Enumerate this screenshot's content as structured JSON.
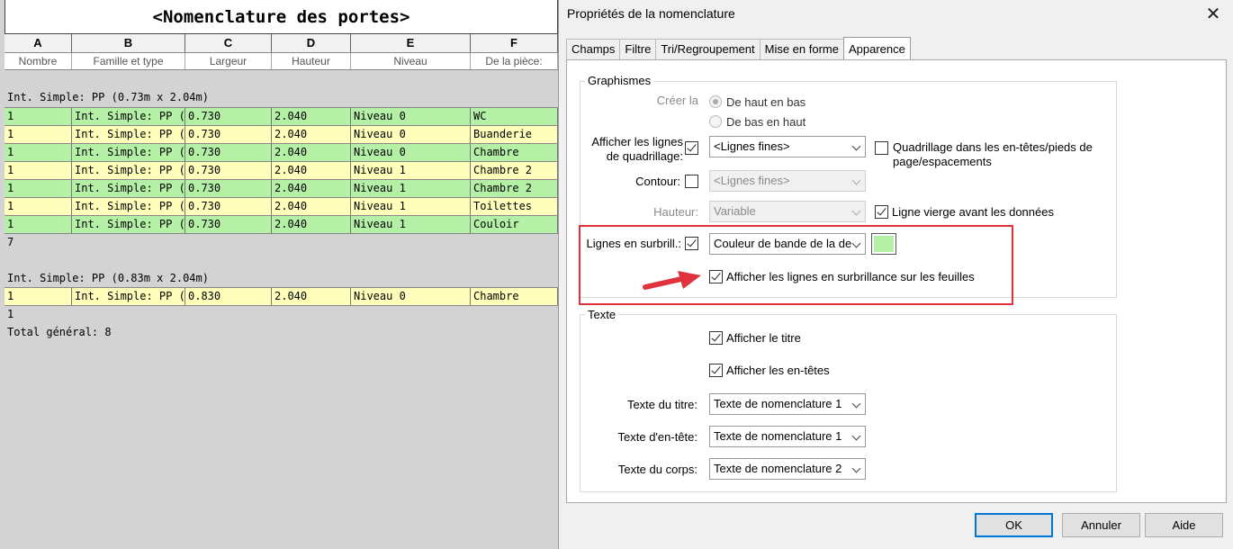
{
  "schedule": {
    "title": "<Nomenclature des portes>",
    "column_letters": [
      "A",
      "B",
      "C",
      "D",
      "E",
      "F"
    ],
    "column_headers": [
      "Nombre",
      "Famille et type",
      "Largeur",
      "Hauteur",
      "Niveau",
      "De la pièce:"
    ],
    "group1": {
      "header": "Int. Simple: PP (0.73m x 2.04m)",
      "rows": [
        [
          "1",
          "Int. Simple: PP (0.73",
          "0.730",
          "2.040",
          "Niveau 0",
          "WC"
        ],
        [
          "1",
          "Int. Simple: PP (0.73",
          "0.730",
          "2.040",
          "Niveau 0",
          "Buanderie"
        ],
        [
          "1",
          "Int. Simple: PP (0.73",
          "0.730",
          "2.040",
          "Niveau 0",
          "Chambre"
        ],
        [
          "1",
          "Int. Simple: PP (0.73",
          "0.730",
          "2.040",
          "Niveau 1",
          "Chambre 2"
        ],
        [
          "1",
          "Int. Simple: PP (0.73",
          "0.730",
          "2.040",
          "Niveau 1",
          "Chambre 2"
        ],
        [
          "1",
          "Int. Simple: PP (0.73",
          "0.730",
          "2.040",
          "Niveau 1",
          "Toilettes"
        ],
        [
          "1",
          "Int. Simple: PP (0.73",
          "0.730",
          "2.040",
          "Niveau 1",
          "Couloir"
        ]
      ],
      "count": "7"
    },
    "group2": {
      "header": "Int. Simple: PP (0.83m x 2.04m)",
      "rows": [
        [
          "1",
          "Int. Simple: PP (0.83",
          "0.830",
          "2.040",
          "Niveau 0",
          "Chambre"
        ]
      ],
      "count": "1"
    },
    "total": "Total général: 8",
    "band_colors": {
      "green": "#b4f0a5",
      "yellow": "#ffffbb"
    }
  },
  "dialog": {
    "title": "Propriétés de la nomenclature",
    "tabs": [
      "Champs",
      "Filtre",
      "Tri/Regroupement",
      "Mise en forme",
      "Apparence"
    ],
    "active_tab": "Apparence",
    "graphics": {
      "group_label": "Graphismes",
      "creer_label": "Créer la",
      "radio_top": "De haut en bas",
      "radio_bottom": "De bas en haut",
      "grid_label": "Afficher les lignes\nde quadrillage:",
      "grid_select": "<Lignes fines>",
      "grid_headers_checkbox": "Quadrillage dans les en-têtes/pieds de\npage/espacements",
      "contour_label": "Contour:",
      "contour_select": "<Lignes fines>",
      "hauteur_label": "Hauteur:",
      "hauteur_select": "Variable",
      "blank_line_checkbox": "Ligne vierge avant les données",
      "highlight_label": "Lignes en surbrill.:",
      "highlight_select": "Couleur de bande de la de",
      "highlight_color": "#b4f0a5",
      "show_on_sheets_checkbox": "Afficher les lignes en surbrillance sur les feuilles"
    },
    "text": {
      "group_label": "Texte",
      "show_title": "Afficher le titre",
      "show_headers": "Afficher les en-têtes",
      "title_text_label": "Texte du titre:",
      "title_text_select": "Texte de nomenclature 1",
      "header_text_label": "Texte d'en-tête:",
      "header_text_select": "Texte de nomenclature 1",
      "body_text_label": "Texte du corps:",
      "body_text_select": "Texte de nomenclature 2"
    },
    "buttons": {
      "ok": "OK",
      "cancel": "Annuler",
      "help": "Aide"
    },
    "accent_color": "#e0323c"
  }
}
